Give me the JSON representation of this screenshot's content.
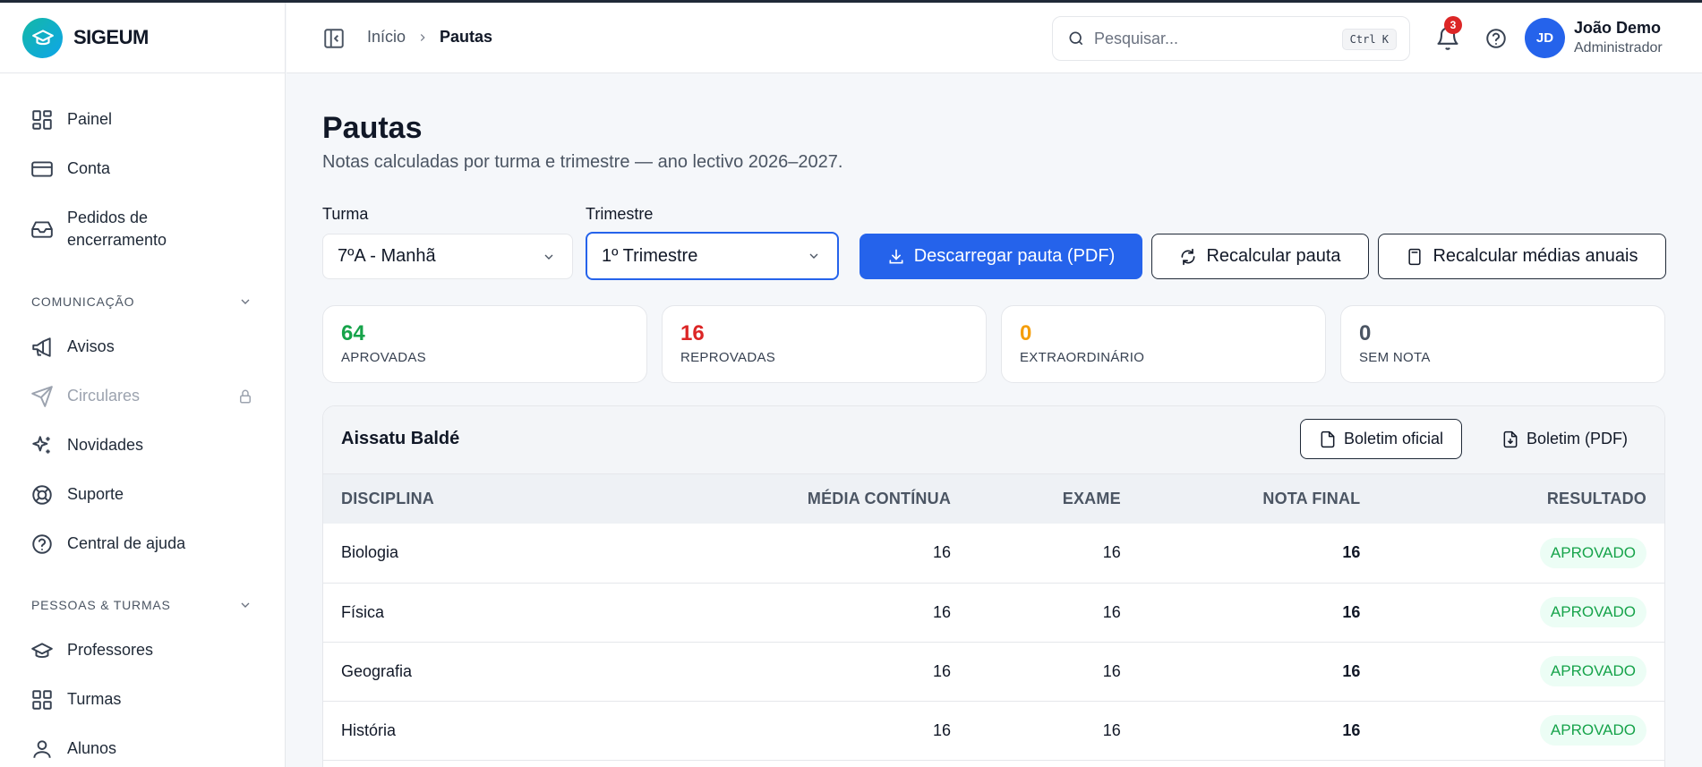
{
  "brand": {
    "name": "SIGEUM"
  },
  "sidebar": {
    "items": [
      {
        "label": "Painel",
        "icon": "dashboard-icon"
      },
      {
        "label": "Conta",
        "icon": "credit-card-icon"
      },
      {
        "label": "Pedidos de encerramento",
        "icon": "inbox-icon"
      }
    ],
    "sections": [
      {
        "label": "COMUNICAÇÃO",
        "items": [
          {
            "label": "Avisos",
            "icon": "megaphone-icon"
          },
          {
            "label": "Circulares",
            "icon": "send-icon",
            "locked": true
          },
          {
            "label": "Novidades",
            "icon": "sparkles-icon"
          },
          {
            "label": "Suporte",
            "icon": "lifebuoy-icon"
          },
          {
            "label": "Central de ajuda",
            "icon": "help-circle-icon"
          }
        ]
      },
      {
        "label": "PESSOAS & TURMAS",
        "items": [
          {
            "label": "Professores",
            "icon": "graduation-cap-icon"
          },
          {
            "label": "Turmas",
            "icon": "grid-icon"
          },
          {
            "label": "Alunos",
            "icon": "user-icon"
          }
        ]
      }
    ]
  },
  "header": {
    "breadcrumb": {
      "home": "Início",
      "current": "Pautas"
    },
    "search": {
      "placeholder": "Pesquisar...",
      "shortcut": "Ctrl K"
    },
    "notifications_count": "3",
    "user": {
      "initials": "JD",
      "name": "João Demo",
      "role": "Administrador"
    }
  },
  "page": {
    "title": "Pautas",
    "subtitle": "Notas calculadas por turma e trimestre — ano lectivo 2026–2027.",
    "filters": {
      "turma_label": "Turma",
      "turma_value": "7ºA - Manhã",
      "trimestre_label": "Trimestre",
      "trimestre_value": "1º Trimestre"
    },
    "actions": {
      "download": "Descarregar pauta (PDF)",
      "recalc": "Recalcular pauta",
      "recalc_annual": "Recalcular médias anuais"
    },
    "stats": [
      {
        "value": "64",
        "label": "APROVADAS",
        "color": "#16a34a"
      },
      {
        "value": "16",
        "label": "REPROVADAS",
        "color": "#dc2626"
      },
      {
        "value": "0",
        "label": "EXTRAORDINÁRIO",
        "color": "#f59e0b"
      },
      {
        "value": "0",
        "label": "SEM NOTA",
        "color": "#4b5563"
      }
    ]
  },
  "student_card": {
    "name": "Aissatu Baldé",
    "btn_official": "Boletim oficial",
    "btn_pdf": "Boletim (PDF)",
    "columns": [
      "DISCIPLINA",
      "MÉDIA CONTÍNUA",
      "EXAME",
      "NOTA FINAL",
      "RESULTADO"
    ],
    "rows": [
      {
        "disciplina": "Biologia",
        "media": "16",
        "exame": "16",
        "final": "16",
        "resultado": "APROVADO"
      },
      {
        "disciplina": "Física",
        "media": "16",
        "exame": "16",
        "final": "16",
        "resultado": "APROVADO"
      },
      {
        "disciplina": "Geografia",
        "media": "16",
        "exame": "16",
        "final": "16",
        "resultado": "APROVADO"
      },
      {
        "disciplina": "História",
        "media": "16",
        "exame": "16",
        "final": "16",
        "resultado": "APROVADO"
      }
    ]
  }
}
